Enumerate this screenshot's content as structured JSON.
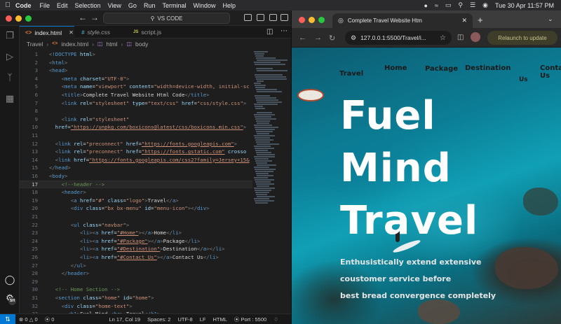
{
  "menubar": {
    "app": "Code",
    "items": [
      "File",
      "Edit",
      "Selection",
      "View",
      "Go",
      "Run",
      "Terminal",
      "Window",
      "Help"
    ],
    "datetime": "Tue 30 Apr  11:57 PM"
  },
  "vscode": {
    "command_center": "VS CODE",
    "tabs": [
      {
        "icon": "<>",
        "label": "index.html",
        "active": true
      },
      {
        "icon": "#",
        "label": "style.css",
        "active": false
      },
      {
        "icon": "JS",
        "label": "script.js",
        "active": false
      }
    ],
    "breadcrumb": [
      "Travel",
      "index.html",
      "html",
      "body"
    ],
    "code": [
      {
        "n": "1",
        "segs": [
          [
            "p",
            "<"
          ],
          [
            "t",
            "!DOCTYPE "
          ],
          [
            "a",
            "html"
          ],
          [
            "p",
            ">"
          ]
        ]
      },
      {
        "n": "2",
        "segs": [
          [
            "p",
            "<"
          ],
          [
            "t",
            "html"
          ],
          [
            "p",
            ">"
          ]
        ]
      },
      {
        "n": "3",
        "segs": [
          [
            "p",
            "<"
          ],
          [
            "t",
            "head"
          ],
          [
            "p",
            ">"
          ]
        ]
      },
      {
        "n": "4",
        "segs": [
          [
            "x",
            "    "
          ],
          [
            "p",
            "<"
          ],
          [
            "t",
            "meta "
          ],
          [
            "a",
            "charset"
          ],
          [
            "x",
            "="
          ],
          [
            "s",
            "\"UTF-8\""
          ],
          [
            "p",
            ">"
          ]
        ]
      },
      {
        "n": "5",
        "segs": [
          [
            "x",
            "    "
          ],
          [
            "p",
            "<"
          ],
          [
            "t",
            "meta "
          ],
          [
            "a",
            "name"
          ],
          [
            "x",
            "="
          ],
          [
            "s",
            "\"viewport\" "
          ],
          [
            "a",
            "content"
          ],
          [
            "x",
            "="
          ],
          [
            "s",
            "\"width=device-width, initial-sc"
          ]
        ]
      },
      {
        "n": "6",
        "segs": [
          [
            "x",
            "    "
          ],
          [
            "p",
            "<"
          ],
          [
            "t",
            "title"
          ],
          [
            "p",
            ">"
          ],
          [
            "x",
            "Complete Travel Website Html Code"
          ],
          [
            "p",
            "</"
          ],
          [
            "t",
            "title"
          ],
          [
            "p",
            ">"
          ]
        ]
      },
      {
        "n": "7",
        "segs": [
          [
            "x",
            "    "
          ],
          [
            "p",
            "<"
          ],
          [
            "t",
            "link "
          ],
          [
            "a",
            "rel"
          ],
          [
            "x",
            "="
          ],
          [
            "s",
            "\"stylesheet\" "
          ],
          [
            "a",
            "type"
          ],
          [
            "x",
            "="
          ],
          [
            "s",
            "\"text/css\" "
          ],
          [
            "a",
            "href"
          ],
          [
            "x",
            "="
          ],
          [
            "s",
            "\"css/style.css\""
          ],
          [
            "p",
            ">"
          ]
        ]
      },
      {
        "n": "8",
        "segs": []
      },
      {
        "n": "9",
        "segs": [
          [
            "x",
            "    "
          ],
          [
            "p",
            "<"
          ],
          [
            "t",
            "link "
          ],
          [
            "a",
            "rel"
          ],
          [
            "x",
            "="
          ],
          [
            "s",
            "\"stylesheet\""
          ]
        ]
      },
      {
        "n": "10",
        "segs": [
          [
            "x",
            "  "
          ],
          [
            "a",
            "href"
          ],
          [
            "x",
            "="
          ],
          [
            "su",
            "\"https://unpkg.com/boxicons@latest/css/boxicons.min.css\""
          ],
          [
            "p",
            ">"
          ]
        ]
      },
      {
        "n": "11",
        "segs": []
      },
      {
        "n": "12",
        "segs": [
          [
            "x",
            "  "
          ],
          [
            "p",
            "<"
          ],
          [
            "t",
            "link "
          ],
          [
            "a",
            "rel"
          ],
          [
            "x",
            "="
          ],
          [
            "s",
            "\"preconnect\" "
          ],
          [
            "a",
            "href"
          ],
          [
            "x",
            "="
          ],
          [
            "su",
            "\"https://fonts.googleapis.com\""
          ],
          [
            "p",
            ">"
          ]
        ]
      },
      {
        "n": "13",
        "segs": [
          [
            "x",
            "  "
          ],
          [
            "p",
            "<"
          ],
          [
            "t",
            "link "
          ],
          [
            "a",
            "rel"
          ],
          [
            "x",
            "="
          ],
          [
            "s",
            "\"preconnect\" "
          ],
          [
            "a",
            "href"
          ],
          [
            "x",
            "="
          ],
          [
            "su",
            "\"https://fonts.gstatic.com\""
          ],
          [
            "x",
            " "
          ],
          [
            "a",
            "crosso"
          ]
        ]
      },
      {
        "n": "14",
        "segs": [
          [
            "x",
            "  "
          ],
          [
            "p",
            "<"
          ],
          [
            "t",
            "link "
          ],
          [
            "a",
            "href"
          ],
          [
            "x",
            "="
          ],
          [
            "su",
            "\"https://fonts.googleapis.com/css2?family=Jersey+15&"
          ]
        ]
      },
      {
        "n": "15",
        "segs": [
          [
            "p",
            "</"
          ],
          [
            "t",
            "head"
          ],
          [
            "p",
            ">"
          ]
        ]
      },
      {
        "n": "16",
        "segs": [
          [
            "p",
            "<"
          ],
          [
            "t",
            "body"
          ],
          [
            "p",
            ">"
          ]
        ]
      },
      {
        "n": "17",
        "segs": [
          [
            "x",
            "    "
          ],
          [
            "c",
            "<!--header -->"
          ]
        ]
      },
      {
        "n": "18",
        "segs": [
          [
            "x",
            "    "
          ],
          [
            "p",
            "<"
          ],
          [
            "t",
            "header"
          ],
          [
            "p",
            ">"
          ]
        ]
      },
      {
        "n": "19",
        "segs": [
          [
            "x",
            "       "
          ],
          [
            "p",
            "<"
          ],
          [
            "t",
            "a "
          ],
          [
            "a",
            "href"
          ],
          [
            "x",
            "="
          ],
          [
            "s",
            "\"#\" "
          ],
          [
            "a",
            "class"
          ],
          [
            "x",
            "="
          ],
          [
            "s",
            "\"logo\""
          ],
          [
            "p",
            ">"
          ],
          [
            "x",
            "Travel"
          ],
          [
            "p",
            "</"
          ],
          [
            "t",
            "a"
          ],
          [
            "p",
            ">"
          ]
        ]
      },
      {
        "n": "20",
        "segs": [
          [
            "x",
            "       "
          ],
          [
            "p",
            "<"
          ],
          [
            "t",
            "div "
          ],
          [
            "a",
            "class"
          ],
          [
            "x",
            "="
          ],
          [
            "s",
            "\"bx bx-menu\" "
          ],
          [
            "a",
            "id"
          ],
          [
            "x",
            "="
          ],
          [
            "s",
            "\"menu-icon\""
          ],
          [
            "p",
            "></"
          ],
          [
            "t",
            "div"
          ],
          [
            "p",
            ">"
          ]
        ]
      },
      {
        "n": "21",
        "segs": []
      },
      {
        "n": "22",
        "segs": [
          [
            "x",
            "       "
          ],
          [
            "p",
            "<"
          ],
          [
            "t",
            "ul "
          ],
          [
            "a",
            "class"
          ],
          [
            "x",
            "="
          ],
          [
            "s",
            "\"navbar\""
          ],
          [
            "p",
            ">"
          ]
        ]
      },
      {
        "n": "23",
        "segs": [
          [
            "x",
            "          "
          ],
          [
            "p",
            "<"
          ],
          [
            "t",
            "li"
          ],
          [
            "p",
            "><"
          ],
          [
            "t",
            "a "
          ],
          [
            "a",
            "href"
          ],
          [
            "x",
            "="
          ],
          [
            "su",
            "\"#Home\""
          ],
          [
            "p",
            "></"
          ],
          [
            "t",
            "a"
          ],
          [
            "p",
            ">"
          ],
          [
            "x",
            "Home"
          ],
          [
            "p",
            "</"
          ],
          [
            "t",
            "li"
          ],
          [
            "p",
            ">"
          ]
        ]
      },
      {
        "n": "24",
        "segs": [
          [
            "x",
            "          "
          ],
          [
            "p",
            "<"
          ],
          [
            "t",
            "li"
          ],
          [
            "p",
            "><"
          ],
          [
            "t",
            "a "
          ],
          [
            "a",
            "href"
          ],
          [
            "x",
            "="
          ],
          [
            "su",
            "\"#Package\""
          ],
          [
            "p",
            "></"
          ],
          [
            "t",
            "a"
          ],
          [
            "p",
            ">"
          ],
          [
            "x",
            "Package"
          ],
          [
            "p",
            "</"
          ],
          [
            "t",
            "li"
          ],
          [
            "p",
            ">"
          ]
        ]
      },
      {
        "n": "25",
        "segs": [
          [
            "x",
            "          "
          ],
          [
            "p",
            "<"
          ],
          [
            "t",
            "li"
          ],
          [
            "p",
            "><"
          ],
          [
            "t",
            "a "
          ],
          [
            "a",
            "href"
          ],
          [
            "x",
            "="
          ],
          [
            "su",
            "\"#Destination\""
          ],
          [
            "p",
            ">"
          ],
          [
            "x",
            "Destination"
          ],
          [
            "p",
            "</"
          ],
          [
            "t",
            "a"
          ],
          [
            "p",
            "></"
          ],
          [
            "t",
            "li"
          ],
          [
            "p",
            ">"
          ]
        ]
      },
      {
        "n": "26",
        "segs": [
          [
            "x",
            "          "
          ],
          [
            "p",
            "<"
          ],
          [
            "t",
            "li"
          ],
          [
            "p",
            "><"
          ],
          [
            "t",
            "a "
          ],
          [
            "a",
            "href"
          ],
          [
            "x",
            "="
          ],
          [
            "su",
            "\"#Contact Us\""
          ],
          [
            "p",
            "></"
          ],
          [
            "t",
            "a"
          ],
          [
            "p",
            ">"
          ],
          [
            "x",
            "Contact Us"
          ],
          [
            "p",
            "</"
          ],
          [
            "t",
            "li"
          ],
          [
            "p",
            ">"
          ]
        ]
      },
      {
        "n": "27",
        "segs": [
          [
            "x",
            "       "
          ],
          [
            "p",
            "</"
          ],
          [
            "t",
            "ul"
          ],
          [
            "p",
            ">"
          ]
        ]
      },
      {
        "n": "28",
        "segs": [
          [
            "x",
            "    "
          ],
          [
            "p",
            "</"
          ],
          [
            "t",
            "header"
          ],
          [
            "p",
            ">"
          ]
        ]
      },
      {
        "n": "29",
        "segs": []
      },
      {
        "n": "30",
        "segs": [
          [
            "x",
            "  "
          ],
          [
            "c",
            "<!-- Home Section -->"
          ]
        ]
      },
      {
        "n": "31",
        "segs": [
          [
            "x",
            "  "
          ],
          [
            "p",
            "<"
          ],
          [
            "t",
            "section "
          ],
          [
            "a",
            "class"
          ],
          [
            "x",
            "="
          ],
          [
            "s",
            "\"home\" "
          ],
          [
            "a",
            "id"
          ],
          [
            "x",
            "="
          ],
          [
            "s",
            "\"home\""
          ],
          [
            "p",
            ">"
          ]
        ]
      },
      {
        "n": "32",
        "segs": [
          [
            "x",
            "    "
          ],
          [
            "p",
            "<"
          ],
          [
            "t",
            "div "
          ],
          [
            "a",
            "class"
          ],
          [
            "x",
            "="
          ],
          [
            "s",
            "\"home-text\""
          ],
          [
            "p",
            ">"
          ]
        ]
      },
      {
        "n": "33",
        "segs": [
          [
            "x",
            "      "
          ],
          [
            "p",
            "<"
          ],
          [
            "t",
            "h1"
          ],
          [
            "p",
            ">"
          ],
          [
            "x",
            "Fuel Mind "
          ],
          [
            "p",
            "<"
          ],
          [
            "t",
            "br"
          ],
          [
            "p",
            "> "
          ],
          [
            "x",
            "Travel"
          ],
          [
            "p",
            "</"
          ],
          [
            "t",
            "h1"
          ],
          [
            "p",
            ">"
          ]
        ]
      }
    ],
    "current_line": "17",
    "status": {
      "errors": "0",
      "warnings": "0",
      "info": "0",
      "position": "Ln 17, Col 19",
      "spaces": "Spaces: 2",
      "encoding": "UTF-8",
      "eol": "LF",
      "language": "HTML",
      "port": "Port : 5500"
    }
  },
  "chrome": {
    "tab_title": "Complete Travel Website Htm",
    "url": "127.0.0.1:5500/Travel/i...",
    "relaunch": "Relaunch to update"
  },
  "site": {
    "logo": "Travel",
    "nav": [
      "Home",
      "Package",
      "Destination",
      "Contact Us"
    ],
    "hero_lines": [
      "Fuel",
      "Mind",
      "Travel"
    ],
    "sub_lines": [
      "Enthusistically extend extensive",
      "coustomer service before",
      "best bread convergence completely"
    ]
  },
  "colors": {
    "accent": "#0078d4",
    "menubar_bg": "#2b2b2d",
    "editor_bg": "#1e1e1e",
    "sea": "#0b7f97"
  }
}
